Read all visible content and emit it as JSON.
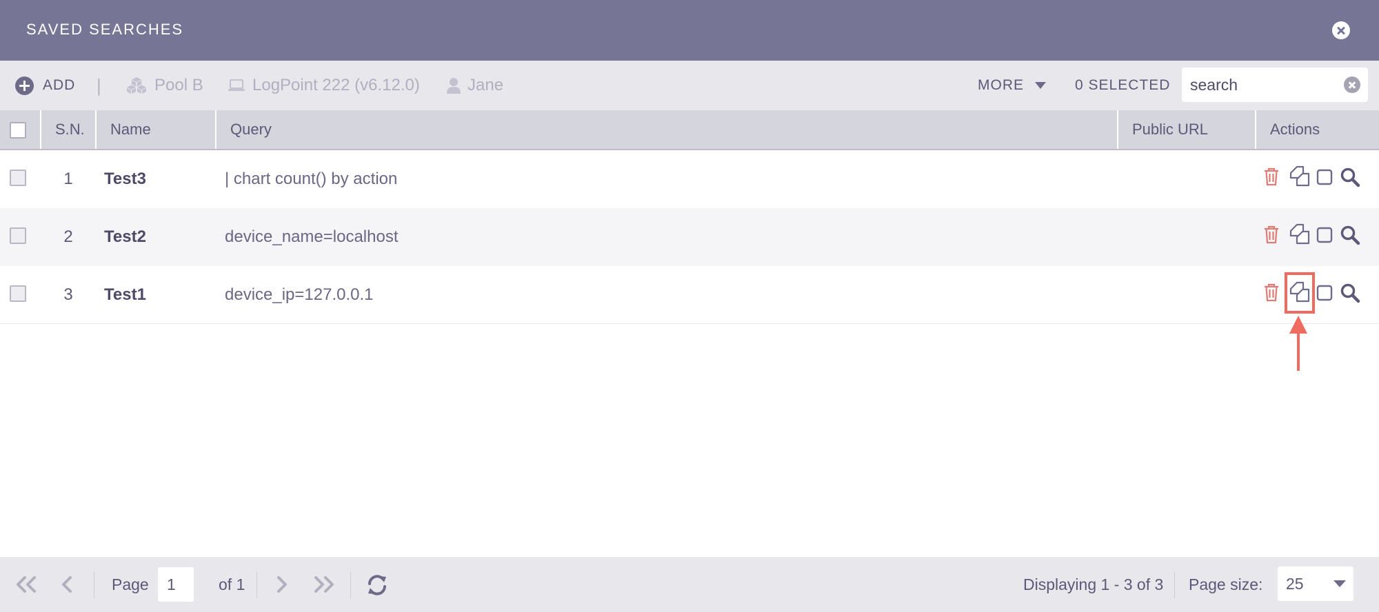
{
  "dialog": {
    "title": "SAVED SEARCHES",
    "close_icon": "close-circle-icon"
  },
  "toolbar": {
    "add_label": "ADD",
    "separator": "|",
    "pool_label": "Pool B",
    "device_label": "LogPoint 222 (v6.12.0)",
    "user_label": "Jane",
    "more_label": "MORE",
    "selected_label": "0 SELECTED",
    "search_value": "search",
    "search_placeholder": "search"
  },
  "table": {
    "columns": [
      "S.N.",
      "Name",
      "Query",
      "Public URL",
      "Actions"
    ],
    "rows": [
      {
        "sn": "1",
        "name": "Test3",
        "query": "| chart count() by action",
        "public_url": ""
      },
      {
        "sn": "2",
        "name": "Test2",
        "query": "device_name=localhost",
        "public_url": ""
      },
      {
        "sn": "3",
        "name": "Test1",
        "query": "device_ip=127.0.0.1",
        "public_url": ""
      }
    ],
    "action_icons": [
      "trash-icon",
      "copy-icon",
      "checkbox-icon",
      "search-icon"
    ]
  },
  "annotation": {
    "highlight_color": "#ef6b60",
    "highlighted_action": "copy-icon",
    "highlighted_row": 3
  },
  "pagination": {
    "page_label": "Page",
    "page_value": "1",
    "of_label": "of 1",
    "displaying": "Displaying 1 - 3 of 3",
    "page_size_label": "Page size:",
    "page_size_value": "25"
  },
  "colors": {
    "titlebar": "#777596",
    "toolbar": "#e7e7ec",
    "header": "#d5d5de",
    "trash": "#e07a74",
    "icon": "#5d5878"
  }
}
